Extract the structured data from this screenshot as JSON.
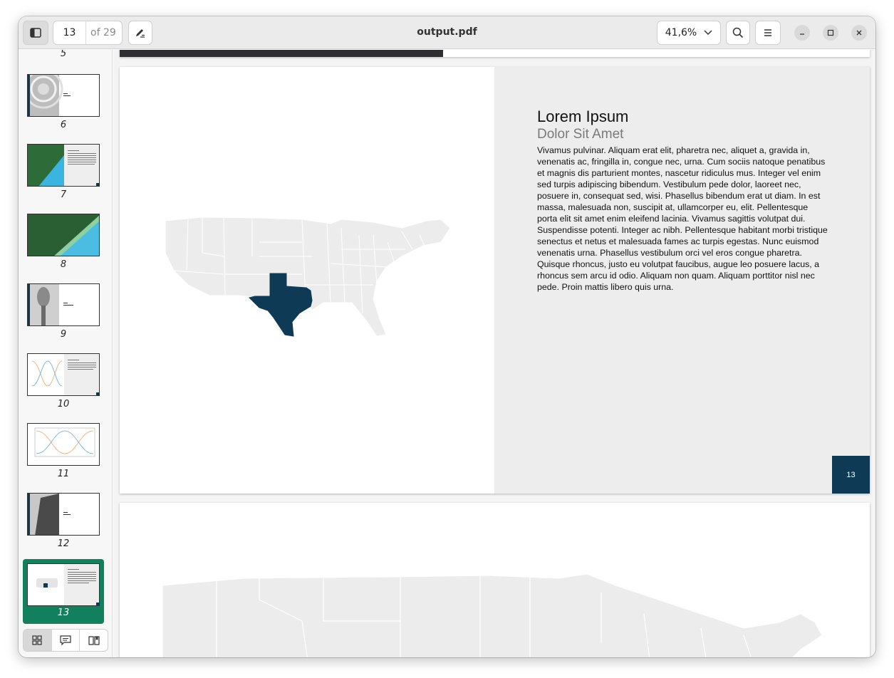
{
  "toolbar": {
    "current_page": "13",
    "page_total": "of 29",
    "title": "output.pdf",
    "zoom": "41,6%",
    "icons": [
      "sidebar-toggle-icon",
      "annotate-pen-icon",
      "chevron-down-icon",
      "search-icon",
      "hamburger-menu-icon",
      "minimize-icon",
      "maximize-icon",
      "close-icon"
    ]
  },
  "sidebar": {
    "thumbnails": [
      {
        "label": "5"
      },
      {
        "label": "6"
      },
      {
        "label": "7"
      },
      {
        "label": "8"
      },
      {
        "label": "9"
      },
      {
        "label": "10"
      },
      {
        "label": "11"
      },
      {
        "label": "12"
      },
      {
        "label": "13",
        "selected": true
      }
    ],
    "footer_icons": [
      "grid-view-icon",
      "annotations-icon",
      "bookmarks-icon"
    ]
  },
  "document": {
    "page13": {
      "heading": "Lorem Ipsum",
      "subheading": "Dolor Sit Amet",
      "body": "Vivamus pulvinar. Aliquam erat elit, pharetra nec, aliquet a, gravida in, venenatis ac, fringilla in, congue nec, urna. Cum sociis natoque penatibus et magnis dis parturient montes, nascetur ridiculus mus. Integer vel enim sed turpis adipiscing bibendum. Vestibulum pede dolor, laoreet nec, posuere in, consequat sed, wisi. Phasellus bibendum erat ut diam. In est massa, malesuada non, suscipit at, ullamcorper eu, elit. Pellentesque porta elit sit amet enim eleifend lacinia. Vivamus sagittis volutpat dui. Suspendisse potenti. Integer ac nibh. Pellentesque habitant morbi tristique senectus et netus et malesuada fames ac turpis egestas. Nunc euismod venenatis urna. Phasellus vestibulum orci vel eros congue pharetra. Quisque rhoncus, justo eu volutpat faucibus, augue leo posuere lacus, a rhoncus sem arcu id odio. Aliquam non quam. Aliquam porttitor nisl nec pede. Proin mattis libero quis urna.",
      "page_number": "13"
    }
  },
  "colors": {
    "accent_navy": "#0f3a55",
    "selection_green": "#12805c",
    "map_gray": "#ececec"
  }
}
